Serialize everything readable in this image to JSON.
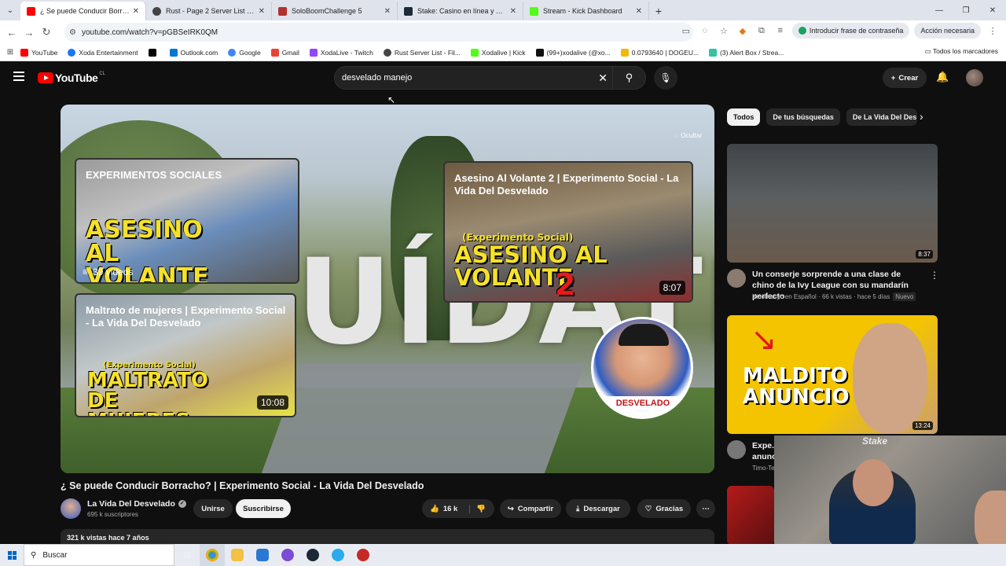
{
  "browser": {
    "tabs": [
      {
        "title": "¿ Se puede Conducir Borracho?",
        "icon": "youtube-icon",
        "color": "#ff0000",
        "active": true
      },
      {
        "title": "Rust - Page 2 Server List - Filter",
        "icon": "rust-icon",
        "color": "#444444"
      },
      {
        "title": "SoloBoomChallenge 5",
        "icon": "solo-icon",
        "color": "#b3312f"
      },
      {
        "title": "Stake: Casino en línea y Apuesta",
        "icon": "stake-icon",
        "color": "#1a2c38"
      },
      {
        "title": "Stream - Kick Dashboard",
        "icon": "kick-icon",
        "color": "#53fc18"
      }
    ],
    "url": "youtube.com/watch?v=pGBSeIRK0QM",
    "passphrase_label": "Introducir frase de contraseña",
    "action_label": "Acción necesaria",
    "bookmarks": [
      {
        "label": "YouTube",
        "color": "#ff0000"
      },
      {
        "label": "Xoda Entertainment",
        "color": "#1877f2"
      },
      {
        "label": "",
        "color": "#000000"
      },
      {
        "label": "Outlook.com",
        "color": "#0078d4"
      },
      {
        "label": "Google",
        "color": "#4285f4"
      },
      {
        "label": "Gmail",
        "color": "#ea4335"
      },
      {
        "label": "XodaLive - Twitch",
        "color": "#9146ff"
      },
      {
        "label": "Rust Server List - Fil...",
        "color": "#444444"
      },
      {
        "label": "Xodalive | Kick",
        "color": "#53fc18"
      },
      {
        "label": "(99+)xodalive (@xo...",
        "color": "#111111"
      },
      {
        "label": "0.0793640 | DOGEU...",
        "color": "#f0b90b"
      },
      {
        "label": "(3) Alert Box / Strea...",
        "color": "#31c3a2"
      }
    ],
    "all_bookmarks": "Todos los marcadores"
  },
  "youtube": {
    "logo_country": "CL",
    "search_value": "desvelado manejo",
    "create_label": "Crear",
    "player": {
      "hide_label": "Ocultar",
      "background_word": "UÍDATE",
      "cards": [
        {
          "title": "EXPERIMENTOS SOCIALES",
          "big": "ASESINO AL VOLANTE",
          "meta": "39 videos"
        },
        {
          "title": "Asesino Al Volante 2 | Experimento Social - La Vida Del Desvelado",
          "tag": "(Experimento Social)",
          "big": "ASESINO AL VOLANTE",
          "num": "2",
          "duration": "8:07"
        },
        {
          "title": "Maltrato de mujeres | Experimento Social - La Vida Del Desvelado",
          "tag": "(Experimento Social)",
          "big": "MALTRATO DE MUJERES",
          "duration": "10:08"
        }
      ],
      "logo_label": "DESVELADO"
    },
    "video": {
      "title": "¿ Se puede Conducir Borracho? | Experimento Social - La Vida Del Desvelado",
      "channel": "La Vida Del Desvelado",
      "subscribers": "695 k suscriptores",
      "join": "Unirse",
      "subscribe": "Suscribirse",
      "likes": "16 k",
      "share": "Compartir",
      "download": "Descargar",
      "thanks": "Gracias",
      "views_line": "321 k vistas  hace 7 años"
    },
    "chips": [
      "Todos",
      "De tus búsquedas",
      "De La Vida Del Des"
    ],
    "recommended": [
      {
        "title": "Un conserje sorprende a una clase de chino de la Ivy League con su mandarín perfecto",
        "channel": "Xiaomanyc en Español",
        "meta": "66 k vistas · hace 5 días",
        "badge": "Nuevo",
        "duration": "8:37"
      },
      {
        "title": "Expe... anunc...",
        "channel": "Timo-Te...",
        "thumb_text": "MALDITO ANUNCIO",
        "duration": "13:24"
      }
    ]
  },
  "webcam": {
    "brand": "Stake"
  },
  "taskbar": {
    "search_placeholder": "Buscar"
  }
}
